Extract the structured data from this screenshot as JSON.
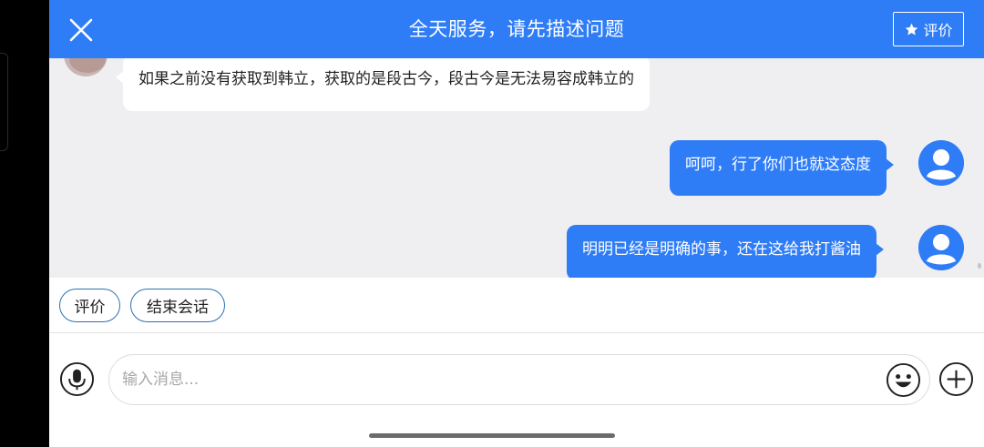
{
  "header": {
    "title": "全天服务，请先描述问题",
    "rate_label": "评价",
    "close_icon": "close-icon",
    "rate_icon": "star-icon",
    "color": "#2f7df6"
  },
  "messages": [
    {
      "side": "agent",
      "text": "如果之前没有获取到韩立，获取的是段古今，段古今是无法易容成韩立的"
    },
    {
      "side": "user",
      "text": "呵呵，行了你们也就这态度"
    },
    {
      "side": "user",
      "text": "明明已经是明确的事，还在这给我打酱油"
    }
  ],
  "quick_actions": [
    "评价",
    "结束会话"
  ],
  "input": {
    "placeholder": "输入消息...",
    "value": "",
    "mic_icon": "microphone-icon",
    "emoji_icon": "emoji-icon",
    "plus_icon": "plus-icon"
  }
}
